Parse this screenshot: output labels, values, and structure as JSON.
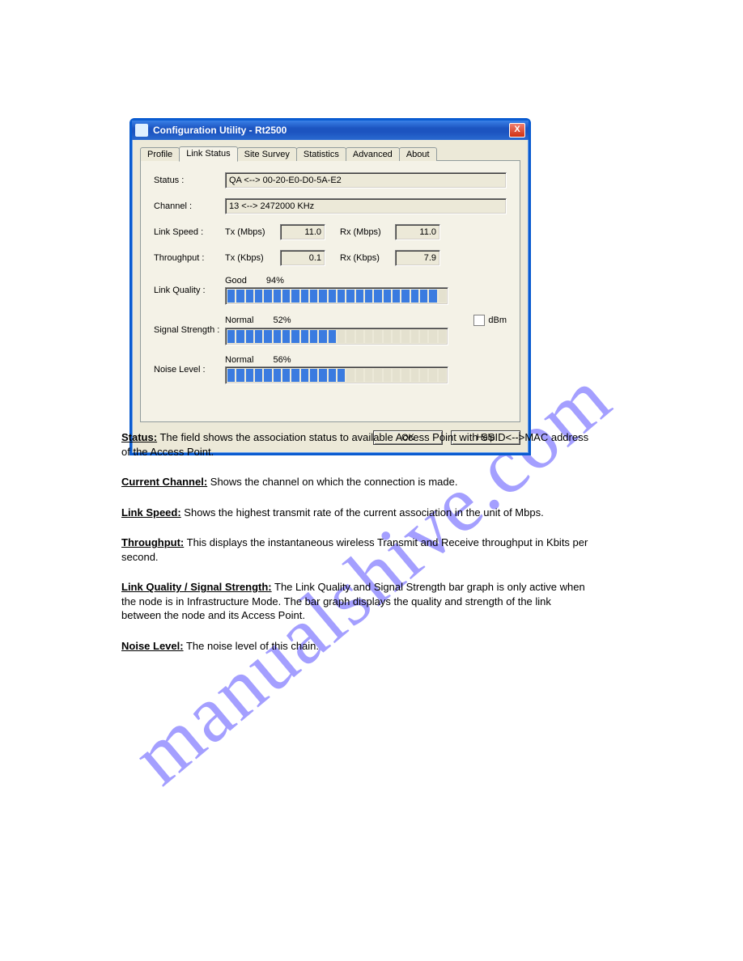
{
  "watermark": "manualshive.com",
  "dialog": {
    "title": "Configuration Utility - Rt2500",
    "close": "X",
    "tabs": [
      "Profile",
      "Link Status",
      "Site Survey",
      "Statistics",
      "Advanced",
      "About"
    ],
    "active_tab": 1,
    "fields": {
      "status_label": "Status :",
      "status_value": "QA <--> 00-20-E0-D0-5A-E2",
      "channel_label": "Channel :",
      "channel_value": "13 <--> 2472000 KHz",
      "linkspeed_label": "Link Speed :",
      "tx_mbps_label": "Tx (Mbps)",
      "tx_mbps_value": "11.0",
      "rx_mbps_label": "Rx (Mbps)",
      "rx_mbps_value": "11.0",
      "throughput_label": "Throughput :",
      "tx_kbps_label": "Tx (Kbps)",
      "tx_kbps_value": "0.1",
      "rx_kbps_label": "Rx (Kbps)",
      "rx_kbps_value": "7.9",
      "linkquality_label": "Link Quality :",
      "linkquality_word": "Good",
      "linkquality_pct": "94%",
      "signal_label": "Signal Strength :",
      "signal_word": "Normal",
      "signal_pct": "52%",
      "dbm_label": "dBm",
      "noise_label": "Noise Level :",
      "noise_word": "Normal",
      "noise_pct": "56%"
    },
    "buttons": {
      "ok": "OK",
      "help": "Help"
    }
  },
  "chart_data": [
    {
      "type": "bar",
      "title": "Link Quality",
      "categories": [
        "Link Quality"
      ],
      "values": [
        94
      ],
      "ylim": [
        0,
        100
      ],
      "xlabel": "",
      "ylabel": "%"
    },
    {
      "type": "bar",
      "title": "Signal Strength",
      "categories": [
        "Signal Strength"
      ],
      "values": [
        52
      ],
      "ylim": [
        0,
        100
      ],
      "xlabel": "",
      "ylabel": "%"
    },
    {
      "type": "bar",
      "title": "Noise Level",
      "categories": [
        "Noise Level"
      ],
      "values": [
        56
      ],
      "ylim": [
        0,
        100
      ],
      "xlabel": "",
      "ylabel": "%"
    }
  ],
  "doc": {
    "status_term": "Status:",
    "status_body": " The field shows the association status to available Access Point with SSID<-->MAC address of the Access Point.",
    "channel_term": "Current Channel:",
    "channel_body": " Shows the channel on which the connection is made.",
    "linkspeed_term": "Link Speed:",
    "linkspeed_body": " Shows the highest transmit rate of the current association in the unit of Mbps.",
    "throughput_term": "Throughput:",
    "throughput_body": " This displays the instantaneous wireless Transmit and Receive throughput in Kbits per second.",
    "linkquality_term": "Link Quality / Signal Strength:",
    "linkquality_body": " The Link Quality and Signal Strength bar graph is only active when the node is in Infrastructure Mode. The bar graph displays the quality and strength of the link between the node and its Access Point.",
    "noise_term": "Noise Level:",
    "noise_body": " The noise level of this chain."
  }
}
